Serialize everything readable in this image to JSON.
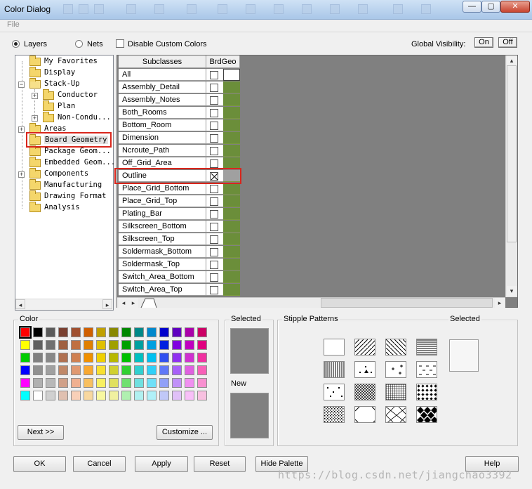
{
  "window": {
    "title": "Color Dialog",
    "min_glyph": "—",
    "max_glyph": "▢",
    "close_glyph": "✕"
  },
  "menu": {
    "file": "File"
  },
  "options": {
    "layers": "Layers",
    "nets": "Nets",
    "disable_custom_colors": "Disable Custom Colors",
    "global_visibility": "Global Visibility:",
    "on": "On",
    "off": "Off",
    "selected_view": "Layers"
  },
  "tree": {
    "items": [
      {
        "label": "My Favorites",
        "level": 1,
        "expander": ""
      },
      {
        "label": "Display",
        "level": 1,
        "expander": ""
      },
      {
        "label": "Stack-Up",
        "level": 1,
        "expander": "−"
      },
      {
        "label": "Conductor",
        "level": 2,
        "expander": "+"
      },
      {
        "label": "Plan",
        "level": 2,
        "expander": ""
      },
      {
        "label": "Non-Condu...",
        "level": 2,
        "expander": "+"
      },
      {
        "label": "Areas",
        "level": 1,
        "expander": "+"
      },
      {
        "label": "Board Geometry",
        "level": 1,
        "expander": "",
        "selected": true
      },
      {
        "label": "Package Geom...",
        "level": 1,
        "expander": ""
      },
      {
        "label": "Embedded Geom...",
        "level": 1,
        "expander": ""
      },
      {
        "label": "Components",
        "level": 1,
        "expander": "+"
      },
      {
        "label": "Manufacturing",
        "level": 1,
        "expander": ""
      },
      {
        "label": "Drawing Format",
        "level": 1,
        "expander": ""
      },
      {
        "label": "Analysis",
        "level": 1,
        "expander": ""
      }
    ]
  },
  "table": {
    "headers": {
      "subclasses": "Subclasses",
      "brdgeo": "BrdGeo"
    },
    "rows": [
      {
        "name": "All",
        "checked": false,
        "color": "#ffffff"
      },
      {
        "name": "Assembly_Detail",
        "checked": false,
        "color": "#6b8e3a"
      },
      {
        "name": "Assembly_Notes",
        "checked": false,
        "color": "#6b8e3a"
      },
      {
        "name": "Both_Rooms",
        "checked": false,
        "color": "#6b8e3a"
      },
      {
        "name": "Bottom_Room",
        "checked": false,
        "color": "#6b8e3a"
      },
      {
        "name": "Dimension",
        "checked": false,
        "color": "#6b8e3a"
      },
      {
        "name": "Ncroute_Path",
        "checked": false,
        "color": "#6b8e3a"
      },
      {
        "name": "Off_Grid_Area",
        "checked": false,
        "color": "#6b8e3a"
      },
      {
        "name": "Outline",
        "checked": true,
        "color": "#a0a0a0"
      },
      {
        "name": "Place_Grid_Bottom",
        "checked": false,
        "color": "#6b8e3a"
      },
      {
        "name": "Place_Grid_Top",
        "checked": false,
        "color": "#6b8e3a"
      },
      {
        "name": "Plating_Bar",
        "checked": false,
        "color": "#6b8e3a"
      },
      {
        "name": "Silkscreen_Bottom",
        "checked": false,
        "color": "#6b8e3a"
      },
      {
        "name": "Silkscreen_Top",
        "checked": false,
        "color": "#6b8e3a"
      },
      {
        "name": "Soldermask_Bottom",
        "checked": false,
        "color": "#6b8e3a"
      },
      {
        "name": "Soldermask_Top",
        "checked": false,
        "color": "#6b8e3a"
      },
      {
        "name": "Switch_Area_Bottom",
        "checked": false,
        "color": "#6b8e3a"
      },
      {
        "name": "Switch_Area_Top",
        "checked": false,
        "color": "#6b8e3a"
      }
    ]
  },
  "color_panel": {
    "legend": "Color",
    "palette": [
      [
        "#ff0000",
        "#000000",
        "#5a5a5a",
        "#7a4030",
        "#a05030",
        "#d06000",
        "#c0a000",
        "#888800",
        "#008800",
        "#008888",
        "#0088cc",
        "#0000cc",
        "#6000c0",
        "#aa00aa",
        "#cc0066"
      ],
      [
        "#ffff00",
        "#606060",
        "#707070",
        "#a06040",
        "#c07040",
        "#e08000",
        "#e0c000",
        "#a0a000",
        "#00a000",
        "#00a0a0",
        "#00a0e0",
        "#0020e0",
        "#8000e0",
        "#c000c0",
        "#e00080"
      ],
      [
        "#00cc00",
        "#808080",
        "#888888",
        "#b07050",
        "#d08050",
        "#f09000",
        "#f0d000",
        "#b8b800",
        "#00c000",
        "#00c0c0",
        "#00c0f0",
        "#3050f0",
        "#9030f0",
        "#d030d0",
        "#f030a0"
      ],
      [
        "#0000ff",
        "#909090",
        "#a0a0a0",
        "#c08868",
        "#e09870",
        "#f8a830",
        "#f8e030",
        "#d0d030",
        "#30d030",
        "#30d0d0",
        "#30d0f8",
        "#6078f8",
        "#a860f8",
        "#e060e0",
        "#f860b8"
      ],
      [
        "#ff00ff",
        "#b0b0b0",
        "#b8b8b8",
        "#d0a088",
        "#f0b090",
        "#f8c060",
        "#f8f060",
        "#e0e060",
        "#70e070",
        "#70e0e0",
        "#70e0f8",
        "#90a0f8",
        "#c090f8",
        "#f090f0",
        "#f890d0"
      ],
      [
        "#00ffff",
        "#ffffff",
        "#d0d0d0",
        "#e0c0b0",
        "#f8d0b8",
        "#f8d8a0",
        "#f8f8a0",
        "#f0f0a0",
        "#b0f0b0",
        "#b0f0f0",
        "#b0f0f8",
        "#c0c8f8",
        "#e0c0f8",
        "#f8c0f8",
        "#f8c0e0"
      ]
    ],
    "next_button": "Next >>",
    "customize_button": "Customize ..."
  },
  "selected_panel": {
    "legend": "Selected",
    "new_label": "New",
    "selected_color": "#808080",
    "new_color": "#808080"
  },
  "stipple_panel": {
    "legend": "Stipple Patterns",
    "selected_label": "Selected",
    "patterns": [
      "solid",
      "diag-right",
      "diag-left",
      "horizontal",
      "vertical",
      "dots-a",
      "plus",
      "dashes",
      "sparse-dots",
      "crosshatch",
      "grid",
      "checker-dots",
      "dense-dots",
      "diamond",
      "diamond-cross",
      "diamond-fill"
    ]
  },
  "buttons": {
    "ok": "OK",
    "cancel": "Cancel",
    "apply": "Apply",
    "reset": "Reset",
    "hide_palette": "Hide Palette",
    "help": "Help"
  },
  "watermark": "https://blog.csdn.net/jiangchao3392"
}
